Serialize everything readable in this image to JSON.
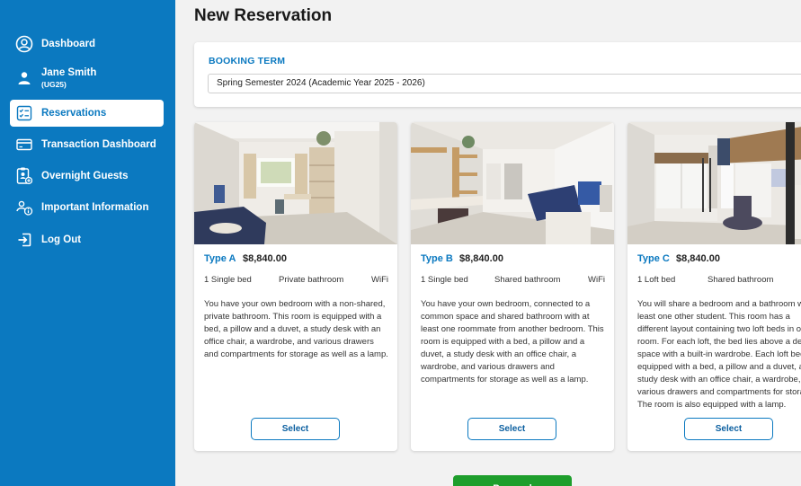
{
  "sidebar": {
    "items": [
      {
        "label": "Dashboard",
        "icon": "user-circle-icon"
      },
      {
        "label": "Jane Smith",
        "sublabel": "(UG25)",
        "icon": "person-icon"
      },
      {
        "label": "Reservations",
        "icon": "checklist-icon",
        "active": true
      },
      {
        "label": "Transaction Dashboard",
        "icon": "credit-card-icon"
      },
      {
        "label": "Overnight Guests",
        "icon": "guest-badge-icon"
      },
      {
        "label": "Important Information",
        "icon": "info-people-icon"
      },
      {
        "label": "Log Out",
        "icon": "logout-icon"
      }
    ]
  },
  "main": {
    "title": "New Reservation",
    "booking": {
      "label": "BOOKING TERM",
      "selected": "Spring Semester 2024 (Academic Year 2025 - 2026)"
    },
    "rooms": [
      {
        "type": "Type A",
        "price": "$8,840.00",
        "features": [
          "1 Single bed",
          "Private bathroom",
          "WiFi"
        ],
        "description": "You have your own bedroom with a non-shared, private bathroom. This room is equipped with a bed, a pillow and a duvet, a study desk with an office chair, a wardrobe, and various drawers and compartments for storage as well as a lamp.",
        "button": "Select"
      },
      {
        "type": "Type B",
        "price": "$8,840.00",
        "features": [
          "1 Single bed",
          "Shared bathroom",
          "WiFi"
        ],
        "description": "You have your own bedroom, connected to a common space and shared bathroom with at least one roommate from another bedroom. This room is equipped with a bed, a pillow and a duvet, a study desk with an office chair, a wardrobe, and various drawers and compartments for storage as well as a lamp.",
        "button": "Select"
      },
      {
        "type": "Type C",
        "price": "$8,840.00",
        "features": [
          "1 Loft bed",
          "Shared bathroom"
        ],
        "description": "You will share a bedroom and a bathroom with at least one other student. This room has a different layout containing two loft beds in one room. For each loft, the bed lies above a desk space with a built-in wardrobe. Each loft bed is equipped with a bed, a pillow and a duvet, a study desk with an office chair, a wardrobe, and various drawers and compartments for storage. The room is also equipped with a lamp.",
        "button": "Select"
      }
    ],
    "proceed_label": "Proceed"
  },
  "colors": {
    "brand": "#0b79c0",
    "proceed": "#1e9e2c",
    "background": "#f2f2f2"
  }
}
